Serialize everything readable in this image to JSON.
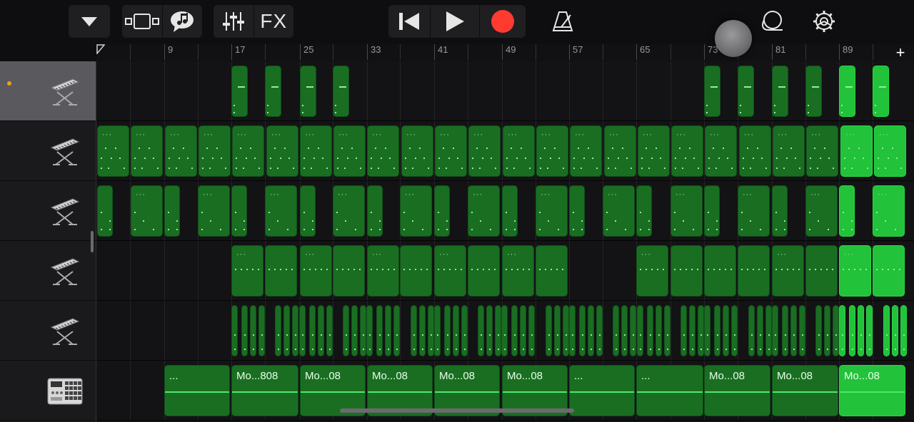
{
  "toolbar": {
    "fx_label": "FX",
    "record_color": "#ff3b30",
    "icons": [
      "view-dropdown-icon",
      "tracks-view-icon",
      "chat-bubble-icon",
      "mixer-sliders-icon",
      "go-to-start-icon",
      "play-icon",
      "record-icon",
      "metronome-icon",
      "loop-icon",
      "settings-gear-icon"
    ]
  },
  "ruler": {
    "bar_labels": [
      "9",
      "17",
      "25",
      "33",
      "41",
      "49",
      "57",
      "65",
      "73",
      "81",
      "89"
    ]
  },
  "tracks": [
    {
      "instrument": "keyboard-stand-icon",
      "selected": true
    },
    {
      "instrument": "keyboard-stand-icon",
      "selected": false
    },
    {
      "instrument": "keyboard-stand-icon",
      "selected": false
    },
    {
      "instrument": "keyboard-stand-icon",
      "selected": false
    },
    {
      "instrument": "keyboard-stand-icon",
      "selected": false
    },
    {
      "instrument": "drum-machine-icon",
      "selected": false
    }
  ],
  "drum_regions": {
    "labels": [
      "...",
      "Mo...808",
      "Mo...08",
      "Mo...08",
      "Mo...08",
      "Mo...08",
      "...",
      "...",
      "Mo...08",
      "Mo...08",
      "Mo...08"
    ]
  },
  "colors": {
    "region": "#1a6e22",
    "region_selected": "#22c23a",
    "accent_dot": "#e8a020"
  }
}
